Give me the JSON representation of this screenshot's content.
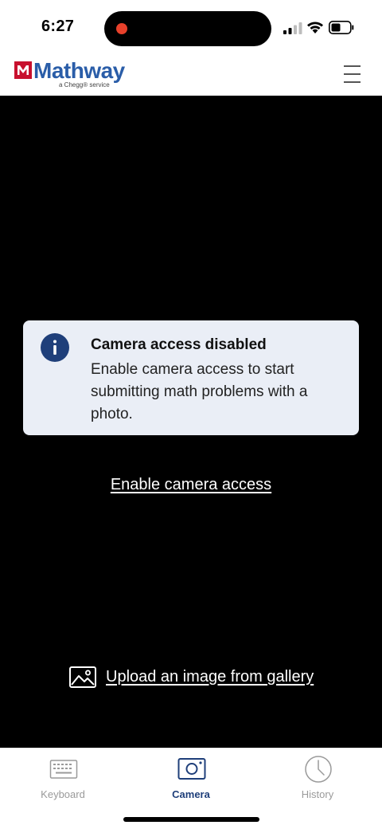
{
  "status_bar": {
    "time": "6:27"
  },
  "header": {
    "logo_text": "Mathway",
    "logo_subtext": "a Chegg® service",
    "brand_color": "#2a5da8"
  },
  "alert": {
    "title": "Camera access disabled",
    "message": "Enable camera access to start submitting math problems with a photo.",
    "background": "#eaeef6",
    "icon": "info-icon"
  },
  "camera": {
    "enable_link": "Enable camera access",
    "upload_link": "Upload an image from gallery",
    "upload_icon": "gallery-icon"
  },
  "tabs": [
    {
      "label": "Keyboard",
      "icon": "keyboard-icon",
      "active": false
    },
    {
      "label": "Camera",
      "icon": "camera-icon",
      "active": true
    },
    {
      "label": "History",
      "icon": "clock-icon",
      "active": false
    }
  ],
  "colors": {
    "accent": "#1f3f7a",
    "recording": "#e8412b",
    "inactive_tab": "#9a9a9a"
  }
}
